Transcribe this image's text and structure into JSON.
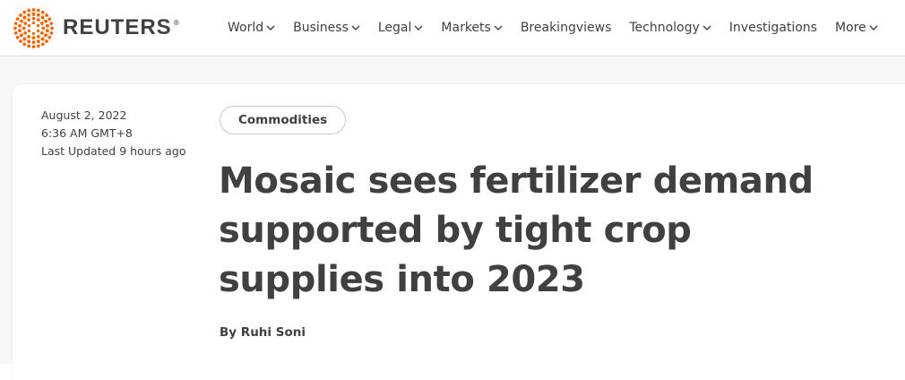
{
  "brand": {
    "name": "REUTERS",
    "registered": "®",
    "accent_color": "#fa6400"
  },
  "nav": {
    "items": [
      {
        "label": "World",
        "dropdown": true
      },
      {
        "label": "Business",
        "dropdown": true
      },
      {
        "label": "Legal",
        "dropdown": true
      },
      {
        "label": "Markets",
        "dropdown": true
      },
      {
        "label": "Breakingviews",
        "dropdown": false
      },
      {
        "label": "Technology",
        "dropdown": true
      },
      {
        "label": "Investigations",
        "dropdown": false
      },
      {
        "label": "More",
        "dropdown": true
      }
    ]
  },
  "article": {
    "date": "August 2, 2022",
    "time": "6:36 AM GMT+8",
    "last_updated": "Last Updated 9 hours ago",
    "category": "Commodities",
    "headline": "Mosaic sees fertilizer demand supported by tight crop supplies into 2023",
    "byline_prefix": "By",
    "author": "Ruhi Soni"
  }
}
